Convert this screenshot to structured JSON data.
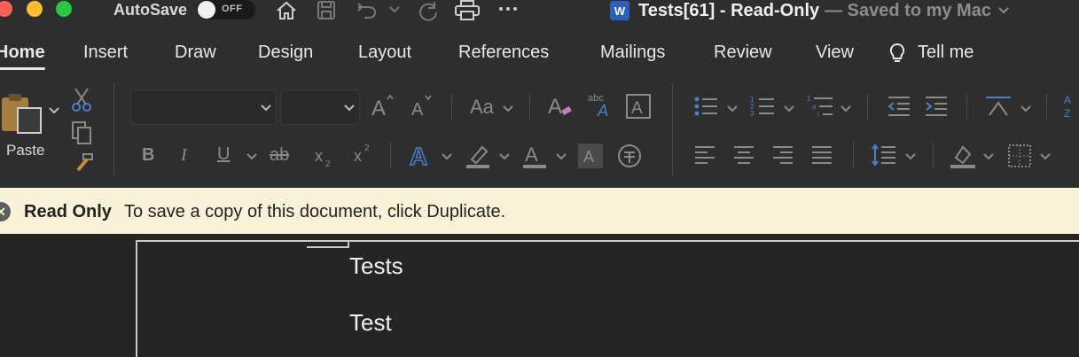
{
  "titlebar": {
    "autosave_label": "AutoSave",
    "toggle_state": "OFF",
    "app_badge": "W",
    "doc_name": "Tests[61]  -  Read-Only",
    "doc_status": "— Saved to my Mac"
  },
  "tabs": [
    "Home",
    "Insert",
    "Draw",
    "Design",
    "Layout",
    "References",
    "Mailings",
    "Review",
    "View",
    "Tell me"
  ],
  "ribbon": {
    "paste_label": "Paste",
    "font_case_label": "Aa"
  },
  "infobar": {
    "title": "Read Only",
    "message": "To save a copy of this document, click Duplicate."
  },
  "document": {
    "lines": [
      "Tests",
      "Test"
    ]
  },
  "colors": {
    "titlebar_bg": "#2e2e2e",
    "infobar_bg": "#f9f1d8",
    "word_blue": "#2b5fb8",
    "red_light": "#ff5f57",
    "yellow_light": "#febc2e",
    "green_light": "#28c840"
  }
}
